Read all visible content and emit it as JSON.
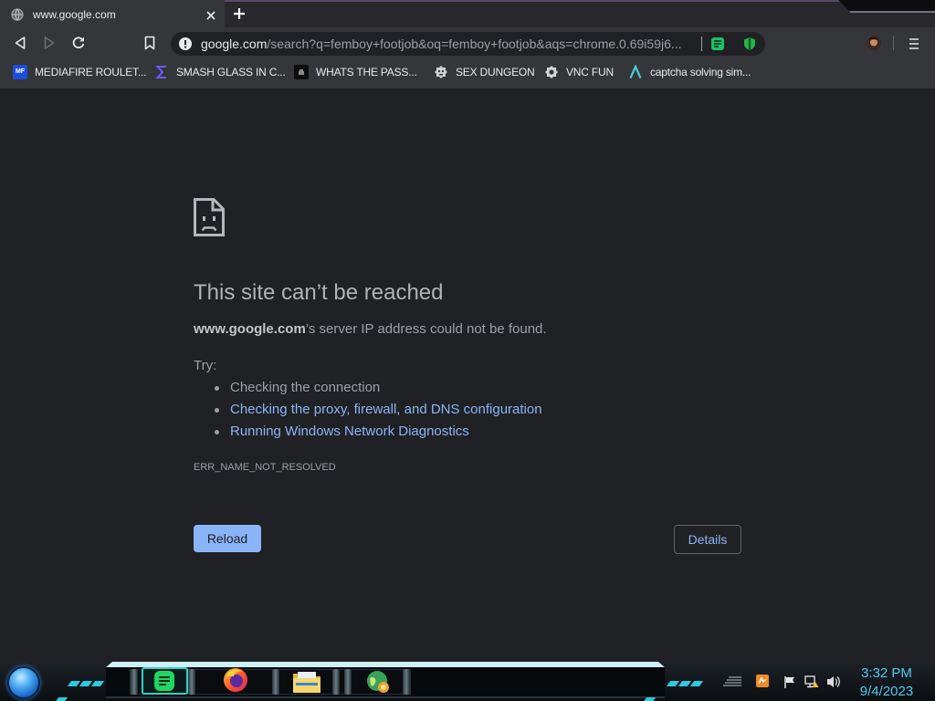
{
  "browser": {
    "tab": {
      "title": "www.google.com",
      "favicon": "globe-icon"
    },
    "omnibox": {
      "security_icon": "info-icon",
      "url_host": "google.com",
      "url_rest": "/search?q=femboy+footjob&oq=femboy+footjob&aqs=chrome.0.69i59j6...",
      "extensions": [
        "green-notes-icon",
        "green-shield-icon"
      ]
    },
    "bookmarks": [
      {
        "label": "MEDIAFIRE ROULET...",
        "icon": "mediafire-icon",
        "icon_text": "MF"
      },
      {
        "label": "SMASH GLASS IN C...",
        "icon": "sigma-icon"
      },
      {
        "label": "WHATS THE PASS...",
        "icon": "black-square-icon"
      },
      {
        "label": "SEX DUNGEON",
        "icon": "skull-icon"
      },
      {
        "label": "VNC FUN",
        "icon": "gear-icon"
      },
      {
        "label": "captcha solving sim...",
        "icon": "lambda-icon"
      }
    ]
  },
  "error_page": {
    "icon": "sad-page-icon",
    "title": "This site can’t be reached",
    "host": "www.google.com",
    "message": "’s server IP address could not be found.",
    "try_label": "Try:",
    "suggestions": [
      {
        "text": "Checking the connection",
        "is_link": false
      },
      {
        "text": "Checking the proxy, firewall, and DNS configuration",
        "is_link": true
      },
      {
        "text": "Running Windows Network Diagnostics",
        "is_link": true
      }
    ],
    "error_code": "ERR_NAME_NOT_RESOLVED",
    "reload_label": "Reload",
    "details_label": "Details"
  },
  "taskbar": {
    "start_button": "start-orb-icon",
    "pinned_apps": [
      {
        "icon": "green-notes-icon",
        "active": true
      },
      {
        "icon": "firefox-icon",
        "active": false
      },
      {
        "icon": "file-explorer-icon",
        "active": false
      },
      {
        "icon": "globe-app-icon",
        "active": false
      }
    ],
    "tray_icons": [
      "tray-overflow-icon",
      "orange-app-icon",
      "flag-icon",
      "network-icon",
      "speaker-icon"
    ],
    "clock": {
      "time": "3:32 PM",
      "date": "9/4/2023"
    }
  },
  "colors": {
    "page_background": "#202124",
    "toolbar_background": "#35363a",
    "link": "#8ab4f8",
    "primary_button": "#8ab4f8",
    "taskbar_accent": "#2ec8e0",
    "clock_text": "#55c7f2"
  }
}
